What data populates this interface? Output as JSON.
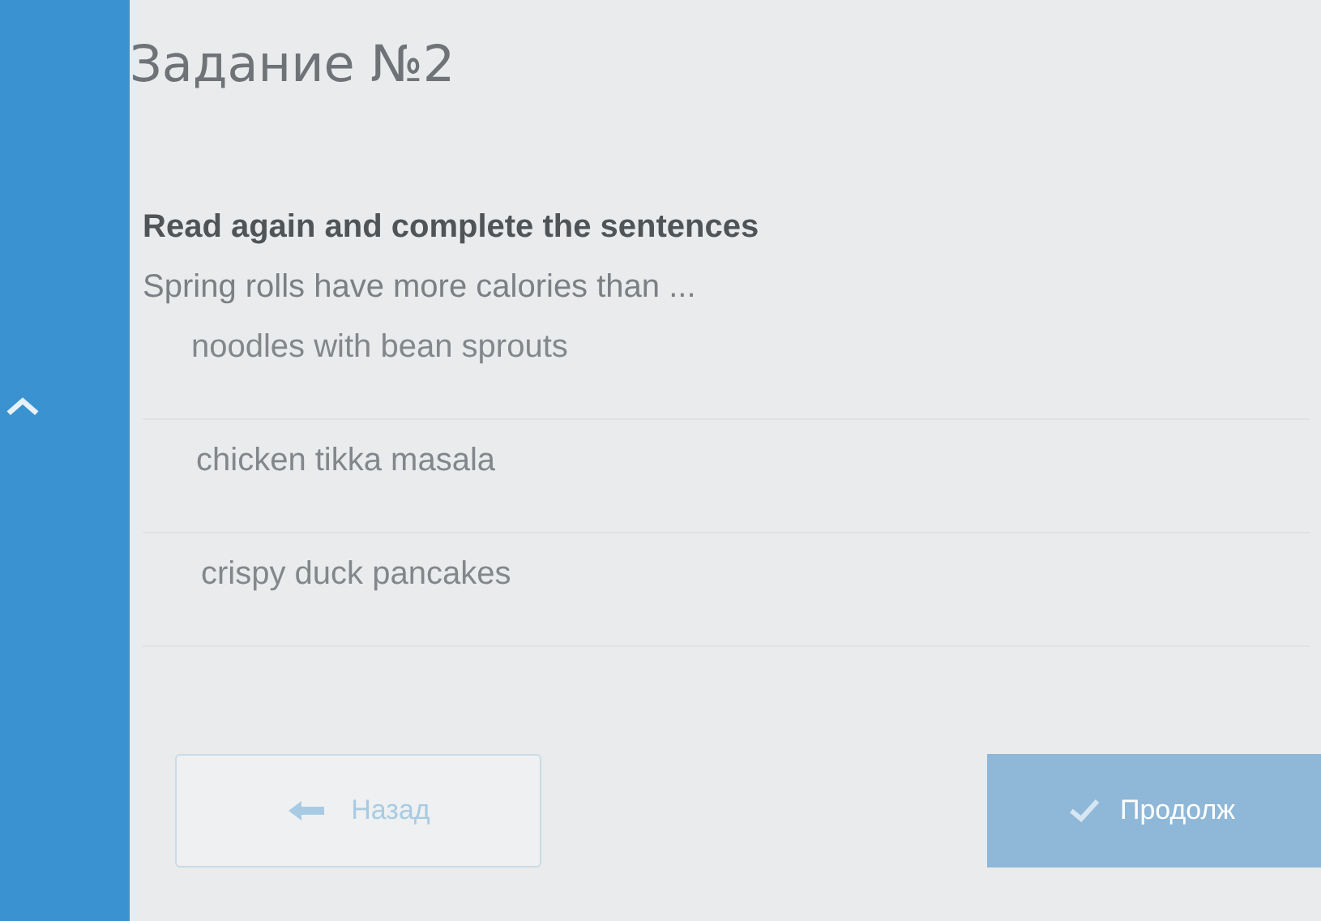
{
  "title": "Задание №2",
  "instruction": "Read again and complete the sentences",
  "question": "Spring rolls have more calories than ...",
  "options": [
    {
      "label": "noodles with bean sprouts",
      "selected": false
    },
    {
      "label": "chicken tikka masala",
      "selected": false
    },
    {
      "label": "crispy duck pancakes",
      "selected": false
    }
  ],
  "back_button": "Назад",
  "next_button": {
    "label": "Продолж",
    "disabled": true
  }
}
